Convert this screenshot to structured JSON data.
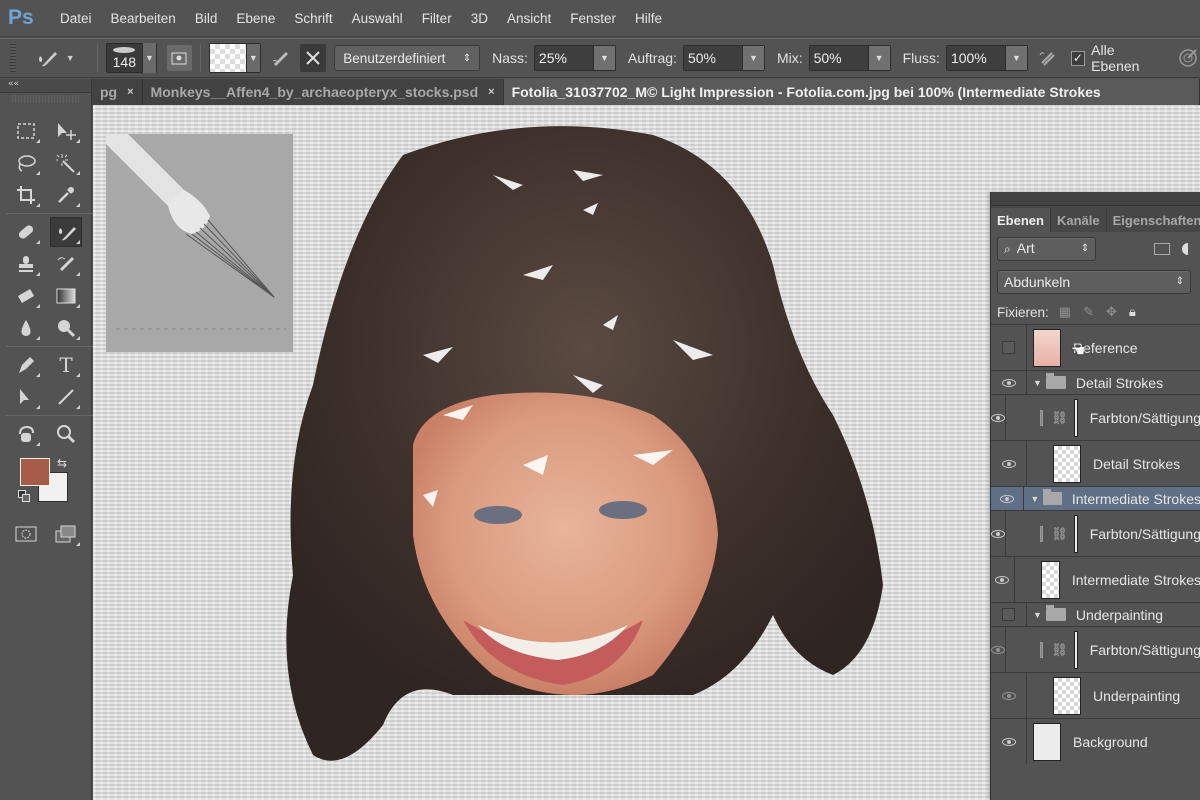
{
  "app": {
    "logo": "Ps"
  },
  "menu": [
    "Datei",
    "Bearbeiten",
    "Bild",
    "Ebene",
    "Schrift",
    "Auswahl",
    "Filter",
    "3D",
    "Ansicht",
    "Fenster",
    "Hilfe"
  ],
  "options": {
    "brush_size": "148",
    "preset": "Benutzerdefiniert",
    "nass_label": "Nass:",
    "nass_value": "25%",
    "auftrag_label": "Auftrag:",
    "auftrag_value": "50%",
    "mix_label": "Mix:",
    "mix_value": "50%",
    "fluss_label": "Fluss:",
    "fluss_value": "100%",
    "all_layers_label": "Alle Ebenen",
    "all_layers_checked": true
  },
  "tabs": [
    {
      "label": "pg",
      "close": "×"
    },
    {
      "label": "Monkeys__Affen4_by_archaeopteryx_stocks.psd",
      "close": "×"
    },
    {
      "label": "Fotolia_31037702_M© Light Impression - Fotolia.com.jpg bei 100% (Intermediate Strokes",
      "active": true
    }
  ],
  "tools": {
    "collapse": "««",
    "foreground_color": "#a55b45",
    "background_color": "#f0f0f0"
  },
  "layers_panel": {
    "tabs": [
      "Ebenen",
      "Kanäle",
      "Eigenschaften"
    ],
    "filter_label": "Art",
    "blend_mode": "Abdunkeln",
    "lock_label": "Fixieren:",
    "layers": [
      {
        "name": "Reference",
        "type": "layer",
        "visible": false
      },
      {
        "name": "Detail Strokes",
        "type": "group",
        "visible": true
      },
      {
        "name": "Farbton/Sättigung",
        "type": "adjustment",
        "visible": true
      },
      {
        "name": "Detail Strokes",
        "type": "layer",
        "visible": true
      },
      {
        "name": "Intermediate Strokes",
        "type": "group",
        "visible": true,
        "selected": true
      },
      {
        "name": "Farbton/Sättigung",
        "type": "adjustment",
        "visible": true
      },
      {
        "name": "Intermediate Strokes",
        "type": "layer",
        "visible": true
      },
      {
        "name": "Underpainting",
        "type": "group",
        "visible": false
      },
      {
        "name": "Farbton/Sättigung",
        "type": "adjustment",
        "visible": true
      },
      {
        "name": "Underpainting",
        "type": "layer",
        "visible": true
      },
      {
        "name": "Background",
        "type": "layer",
        "visible": true
      }
    ]
  }
}
